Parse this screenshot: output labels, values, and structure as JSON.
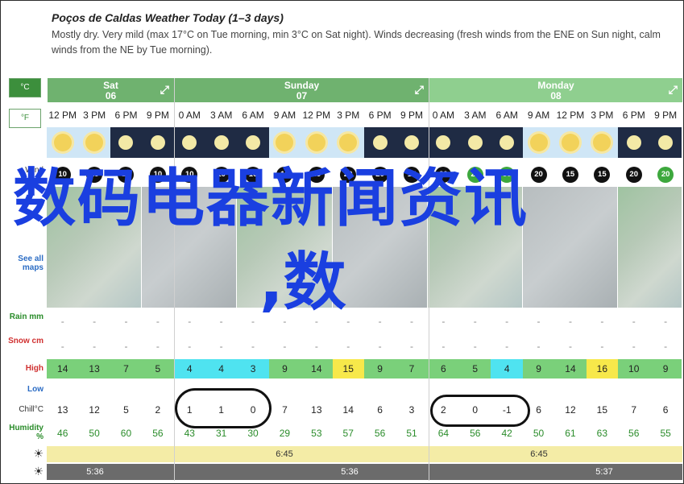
{
  "header": {
    "title": "Poços de Caldas Weather Today (1–3 days)",
    "summary": "Mostly dry. Very mild (max 17°C on Tue morning, min 3°C on Sat night). Winds decreasing (fresh winds from the ENE on Sun night, calm winds from the NE by Tue morning)."
  },
  "units": {
    "celsius": "°C",
    "fahrenheit": "°F"
  },
  "row_labels": {
    "wind": "Wind",
    "see_all_maps": "See all maps",
    "rain": "Rain mm",
    "snow": "Snow cm",
    "high": "High",
    "low": "Low",
    "chill": "Chill°C",
    "humidity": "Humidity %"
  },
  "days": [
    {
      "name": "Sat",
      "date": "06"
    },
    {
      "name": "Sunday",
      "date": "07"
    },
    {
      "name": "Monday",
      "date": "08"
    }
  ],
  "times": [
    "12 PM",
    "3 PM",
    "6 PM",
    "9 PM",
    "0 AM",
    "3 AM",
    "6 AM",
    "9 AM",
    "12 PM",
    "3 PM",
    "6 PM",
    "9 PM",
    "0 AM",
    "3 AM",
    "6 AM",
    "9 AM",
    "12 PM",
    "3 PM",
    "6 PM",
    "9 PM"
  ],
  "icons": [
    "sun",
    "sun",
    "moon",
    "moon",
    "moon",
    "moon",
    "moon",
    "sun",
    "sun",
    "sun",
    "moon",
    "moon",
    "moon",
    "moon",
    "moon",
    "sun",
    "sun",
    "sun",
    "moon",
    "moon"
  ],
  "wind": [
    "10",
    "15",
    "15",
    "10",
    "10",
    "10",
    "10",
    "10",
    "15",
    "20",
    "20",
    "15",
    "20",
    "25",
    "30",
    "20",
    "15",
    "15",
    "20",
    "20"
  ],
  "wind_green": [
    false,
    false,
    false,
    false,
    false,
    false,
    false,
    false,
    false,
    false,
    false,
    false,
    false,
    true,
    true,
    false,
    false,
    false,
    false,
    true
  ],
  "rain": [
    "-",
    "-",
    "-",
    "-",
    "-",
    "-",
    "-",
    "-",
    "-",
    "-",
    "-",
    "-",
    "-",
    "-",
    "-",
    "-",
    "-",
    "-",
    "-",
    "-"
  ],
  "snow": [
    "-",
    "-",
    "-",
    "-",
    "-",
    "-",
    "-",
    "-",
    "-",
    "-",
    "-",
    "-",
    "-",
    "-",
    "-",
    "-",
    "-",
    "-",
    "-",
    "-"
  ],
  "high": [
    "14",
    "13",
    "7",
    "5",
    "4",
    "4",
    "3",
    "9",
    "14",
    "15",
    "9",
    "7",
    "6",
    "5",
    "4",
    "9",
    "14",
    "16",
    "10",
    "9"
  ],
  "high_colors": [
    "green",
    "green",
    "green",
    "green",
    "cyan",
    "cyan",
    "cyan",
    "green",
    "green",
    "yellow",
    "green",
    "green",
    "green",
    "green",
    "cyan",
    "green",
    "green",
    "yellow",
    "green",
    "green"
  ],
  "chill": [
    "13",
    "12",
    "5",
    "2",
    "1",
    "1",
    "0",
    "7",
    "13",
    "14",
    "6",
    "3",
    "2",
    "0",
    "-1",
    "6",
    "12",
    "15",
    "7",
    "6"
  ],
  "humidity": [
    "46",
    "50",
    "60",
    "56",
    "43",
    "31",
    "30",
    "29",
    "53",
    "57",
    "56",
    "51",
    "64",
    "56",
    "42",
    "50",
    "61",
    "63",
    "56",
    "55"
  ],
  "sunrise": [
    "6:45",
    "6:45"
  ],
  "sunset": [
    "5:36",
    "5:36",
    "5:37"
  ],
  "watermark": {
    "line1": "数码电器新闻资讯",
    "line2": ",数"
  }
}
